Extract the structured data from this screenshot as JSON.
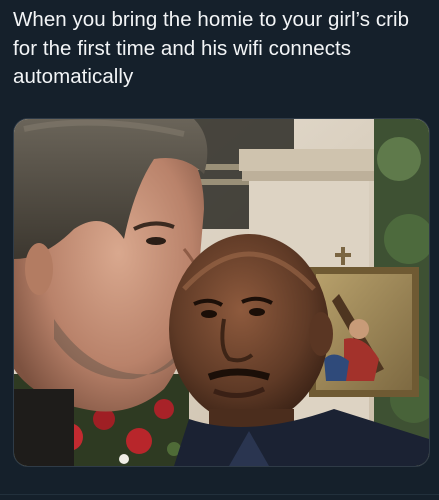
{
  "tweet": {
    "text": "When you bring the homie to your girl’s crib for the first time and his wifi connects automatically"
  },
  "media": {
    "type": "photo",
    "colors": {
      "background": "#15202b",
      "text": "#f2f4f6"
    }
  }
}
